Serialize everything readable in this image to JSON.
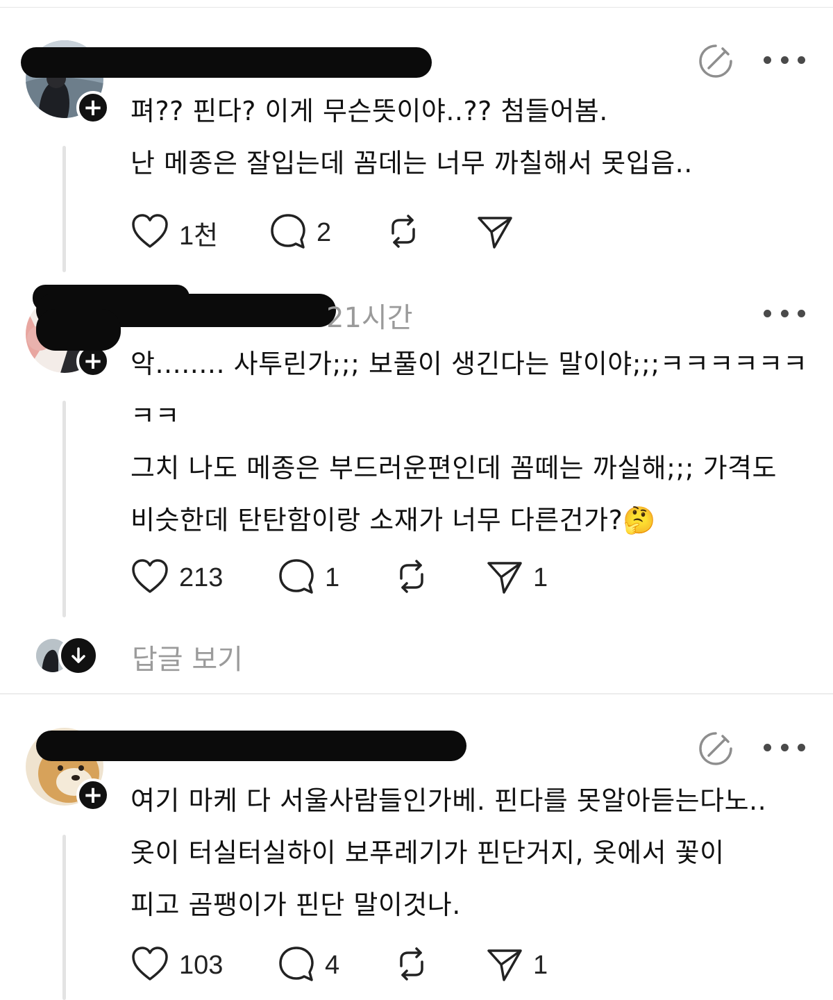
{
  "posts": [
    {
      "time": "",
      "lines": "펴?? 핀다? 이게 무슨뜻이야..?? 첨들어봄.\n난 메종은 잘입는데 꼼데는 너무 까칠해서 못입음..",
      "likes": "1천",
      "comments": "2",
      "shares": ""
    },
    {
      "time": "21시간",
      "lines": "악........ 사투린가;;; 보풀이 생긴다는 말이야;;;ㅋㅋㅋㅋㅋㅋ\nㅋㅋ\n그치 나도 메종은 부드러운편인데 꼼떼는 까실해;;; 가격도\n비슷한데 탄탄함이랑 소재가 너무 다른건가?🤔",
      "likes": "213",
      "comments": "1",
      "shares": "1"
    },
    {
      "time": "",
      "lines": "여기 마케 다 서울사람들인가베. 핀다를 못알아듣는다노..\n옷이 터실터실하이  보푸레기가 핀단거지,  옷에서 꽃이\n피고 곰팽이가 핀단 말이것나.",
      "likes": "103",
      "comments": "4",
      "shares": "1"
    }
  ],
  "view_replies_label": "답글 보기",
  "icons": {
    "follow": "plus-icon",
    "like": "heart-icon",
    "comment": "comment-bubble-icon",
    "repost": "repost-icon",
    "share": "send-icon",
    "edit": "edit-circle-icon",
    "more": "more-dots-icon",
    "expand": "arrow-down-icon"
  },
  "colors": {
    "text": "#111111",
    "muted": "#9a9a9a",
    "badge": "#111111",
    "thread_line": "#e3e3e3"
  }
}
